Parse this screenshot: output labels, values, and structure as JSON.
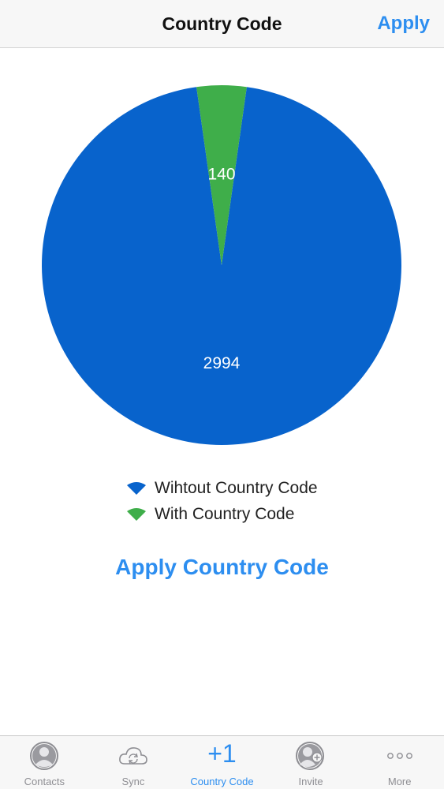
{
  "nav": {
    "title": "Country Code",
    "apply_label": "Apply"
  },
  "chart_data": {
    "type": "pie",
    "categories": [
      "Wihtout Country Code",
      "With Country Code"
    ],
    "values": [
      2994,
      140
    ],
    "colors": [
      "#0863cc",
      "#3fae4a"
    ],
    "data_labels": [
      "2994",
      "140"
    ],
    "legend_position": "bottom"
  },
  "legend": {
    "items": [
      {
        "label": "Wihtout Country Code",
        "color": "#0863cc"
      },
      {
        "label": "With Country Code",
        "color": "#3fae4a"
      }
    ]
  },
  "action": {
    "apply_country_code_label": "Apply Country Code"
  },
  "tabbar": {
    "active_color": "#2d8ef0",
    "inactive_color": "#8e8e93",
    "tabs": [
      {
        "label": "Contacts",
        "icon": "contacts-icon",
        "active": false
      },
      {
        "label": "Sync",
        "icon": "sync-cloud-icon",
        "active": false
      },
      {
        "label": "Country Code",
        "icon": "plus-one-icon",
        "glyph": "+1",
        "active": true
      },
      {
        "label": "Invite",
        "icon": "invite-icon",
        "active": false
      },
      {
        "label": "More",
        "icon": "more-icon",
        "active": false
      }
    ]
  }
}
